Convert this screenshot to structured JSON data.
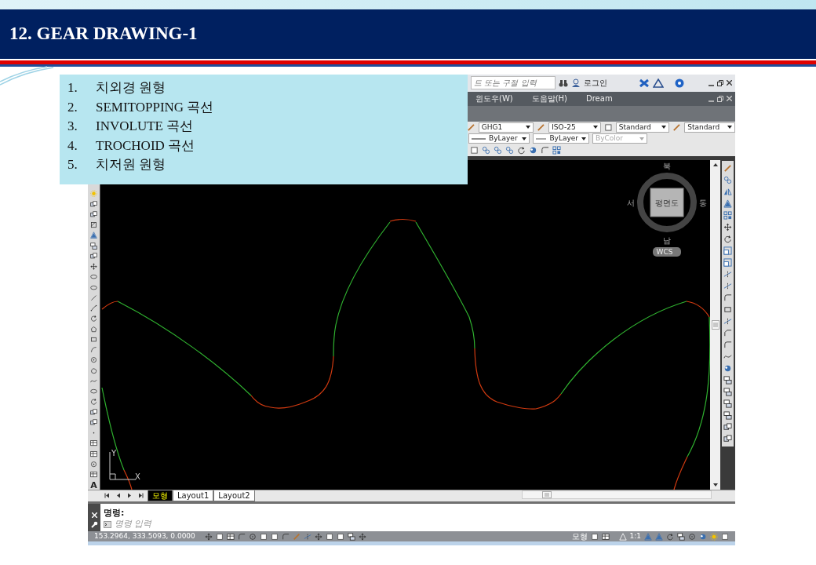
{
  "slide": {
    "title": "12.  GEAR DRAWING-1",
    "list": [
      {
        "number": "1.",
        "text": "치외경 원형"
      },
      {
        "number": "2.",
        "text": "SEMITOPPING  곡선"
      },
      {
        "number": "3.",
        "text": "INVOLUTE  곡선"
      },
      {
        "number": "4.",
        "text": "TROCHOID 곡선"
      },
      {
        "number": "5.",
        "text": "치저원 원형"
      }
    ]
  },
  "app": {
    "search": {
      "placeholder": "드 또는 구절 입력"
    },
    "login": "로그인",
    "menu": [
      "윈도우(W)",
      "도움말(H)",
      "Dream"
    ],
    "style_dropdowns": [
      "GHG1",
      "ISO-25",
      "Standard",
      "Standard"
    ],
    "property_dropdowns": [
      {
        "value": "ByLayer",
        "disabled": false
      },
      {
        "value": "ByLayer",
        "disabled": false
      },
      {
        "value": "ByColor",
        "disabled": true
      }
    ],
    "viewcube": {
      "north": "북",
      "east": "동",
      "south": "남",
      "west": "서",
      "face": "평면도",
      "wcs": "WCS"
    },
    "ucs": {
      "y": "Y",
      "x": "X"
    },
    "text_tool": "A",
    "layout_tabs": [
      {
        "label": "모형",
        "selected": true
      },
      {
        "label": "Layout1",
        "selected": false
      },
      {
        "label": "Layout2",
        "selected": false
      }
    ],
    "command": {
      "prompt": "명령:",
      "placeholder": "명령 입력"
    },
    "status": {
      "coordinates": "153.2964, 333.5093, 0.0000",
      "model": "모형",
      "scale": "1:1"
    }
  }
}
